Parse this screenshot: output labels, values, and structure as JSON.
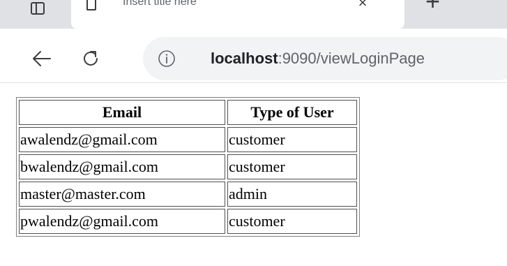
{
  "tab": {
    "title": "Insert title here",
    "close_symbol": "×",
    "new_tab_symbol": "+"
  },
  "toolbar": {
    "back_icon": "back-arrow-icon",
    "refresh_icon": "refresh-icon",
    "info_icon": "info-icon"
  },
  "address": {
    "host": "localhost",
    "rest": ":9090/viewLoginPage"
  },
  "table": {
    "headers": [
      "Email",
      "Type of User"
    ],
    "rows": [
      [
        "awalendz@gmail.com",
        "customer"
      ],
      [
        "bwalendz@gmail.com",
        "customer"
      ],
      [
        "master@master.com",
        "admin"
      ],
      [
        "pwalendz@gmail.com",
        "customer"
      ]
    ]
  }
}
